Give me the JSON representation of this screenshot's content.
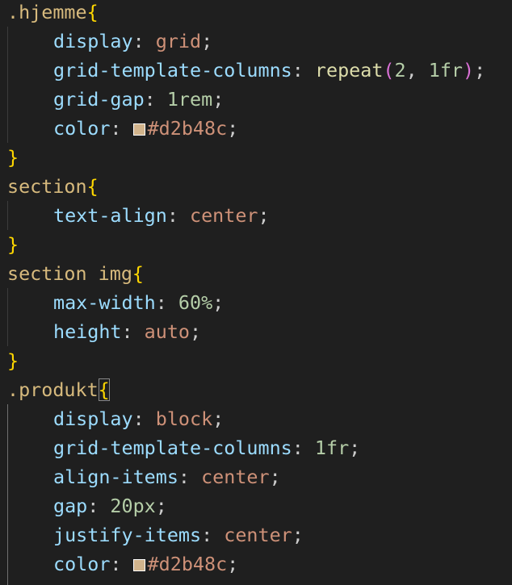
{
  "editor": {
    "lines": [
      {
        "indent": false,
        "parts": [
          {
            "t": "sel",
            "v": ".hjemme"
          },
          {
            "t": "brace",
            "v": "{"
          }
        ]
      },
      {
        "indent": true,
        "parts": [
          {
            "t": "prop",
            "v": "display"
          },
          {
            "t": "punc",
            "v": ": "
          },
          {
            "t": "kw",
            "v": "grid"
          },
          {
            "t": "punc",
            "v": ";"
          }
        ]
      },
      {
        "indent": true,
        "parts": [
          {
            "t": "prop",
            "v": "grid-template-columns"
          },
          {
            "t": "punc",
            "v": ": "
          },
          {
            "t": "fn",
            "v": "repeat"
          },
          {
            "t": "paren",
            "v": "("
          },
          {
            "t": "num",
            "v": "2"
          },
          {
            "t": "punc",
            "v": ", "
          },
          {
            "t": "num",
            "v": "1fr"
          },
          {
            "t": "paren",
            "v": ")"
          },
          {
            "t": "punc",
            "v": ";"
          }
        ]
      },
      {
        "indent": true,
        "parts": [
          {
            "t": "prop",
            "v": "grid-gap"
          },
          {
            "t": "punc",
            "v": ": "
          },
          {
            "t": "num",
            "v": "1rem"
          },
          {
            "t": "punc",
            "v": ";"
          }
        ]
      },
      {
        "indent": true,
        "parts": [
          {
            "t": "prop",
            "v": "color"
          },
          {
            "t": "punc",
            "v": ": "
          },
          {
            "t": "swatch",
            "v": "#d2b48c"
          },
          {
            "t": "kw",
            "v": "#d2b48c"
          },
          {
            "t": "punc",
            "v": ";"
          }
        ]
      },
      {
        "indent": false,
        "parts": [
          {
            "t": "brace",
            "v": "}"
          }
        ]
      },
      {
        "indent": false,
        "parts": [
          {
            "t": "sel",
            "v": "section"
          },
          {
            "t": "brace",
            "v": "{"
          }
        ]
      },
      {
        "indent": true,
        "parts": [
          {
            "t": "prop",
            "v": "text-align"
          },
          {
            "t": "punc",
            "v": ": "
          },
          {
            "t": "kw",
            "v": "center"
          },
          {
            "t": "punc",
            "v": ";"
          }
        ]
      },
      {
        "indent": false,
        "parts": [
          {
            "t": "brace",
            "v": "}"
          }
        ]
      },
      {
        "indent": false,
        "parts": [
          {
            "t": "sel",
            "v": "section img"
          },
          {
            "t": "brace",
            "v": "{"
          }
        ]
      },
      {
        "indent": true,
        "parts": [
          {
            "t": "prop",
            "v": "max-width"
          },
          {
            "t": "punc",
            "v": ": "
          },
          {
            "t": "num",
            "v": "60%"
          },
          {
            "t": "punc",
            "v": ";"
          }
        ]
      },
      {
        "indent": true,
        "parts": [
          {
            "t": "prop",
            "v": "height"
          },
          {
            "t": "punc",
            "v": ": "
          },
          {
            "t": "kw",
            "v": "auto"
          },
          {
            "t": "punc",
            "v": ";"
          }
        ]
      },
      {
        "indent": false,
        "parts": [
          {
            "t": "brace",
            "v": "}"
          }
        ]
      },
      {
        "indent": false,
        "parts": [
          {
            "t": "sel",
            "v": ".produkt"
          },
          {
            "t": "brace-match",
            "v": "{"
          }
        ]
      },
      {
        "indent": true,
        "parts": [
          {
            "t": "prop",
            "v": "display"
          },
          {
            "t": "punc",
            "v": ": "
          },
          {
            "t": "kw",
            "v": "block"
          },
          {
            "t": "punc",
            "v": ";"
          }
        ]
      },
      {
        "indent": true,
        "parts": [
          {
            "t": "prop",
            "v": "grid-template-columns"
          },
          {
            "t": "punc",
            "v": ": "
          },
          {
            "t": "num",
            "v": "1fr"
          },
          {
            "t": "punc",
            "v": ";"
          }
        ]
      },
      {
        "indent": true,
        "parts": [
          {
            "t": "prop",
            "v": "align-items"
          },
          {
            "t": "punc",
            "v": ": "
          },
          {
            "t": "kw",
            "v": "center"
          },
          {
            "t": "punc",
            "v": ";"
          }
        ]
      },
      {
        "indent": true,
        "parts": [
          {
            "t": "prop",
            "v": "gap"
          },
          {
            "t": "punc",
            "v": ": "
          },
          {
            "t": "num",
            "v": "20px"
          },
          {
            "t": "punc",
            "v": ";"
          }
        ]
      },
      {
        "indent": true,
        "parts": [
          {
            "t": "prop",
            "v": "justify-items"
          },
          {
            "t": "punc",
            "v": ": "
          },
          {
            "t": "kw",
            "v": "center"
          },
          {
            "t": "punc",
            "v": ";"
          }
        ]
      },
      {
        "indent": true,
        "parts": [
          {
            "t": "prop",
            "v": "color"
          },
          {
            "t": "punc",
            "v": ": "
          },
          {
            "t": "swatch",
            "v": "#d2b48c"
          },
          {
            "t": "kw",
            "v": "#d2b48c"
          },
          {
            "t": "punc",
            "v": ";"
          }
        ]
      }
    ]
  }
}
